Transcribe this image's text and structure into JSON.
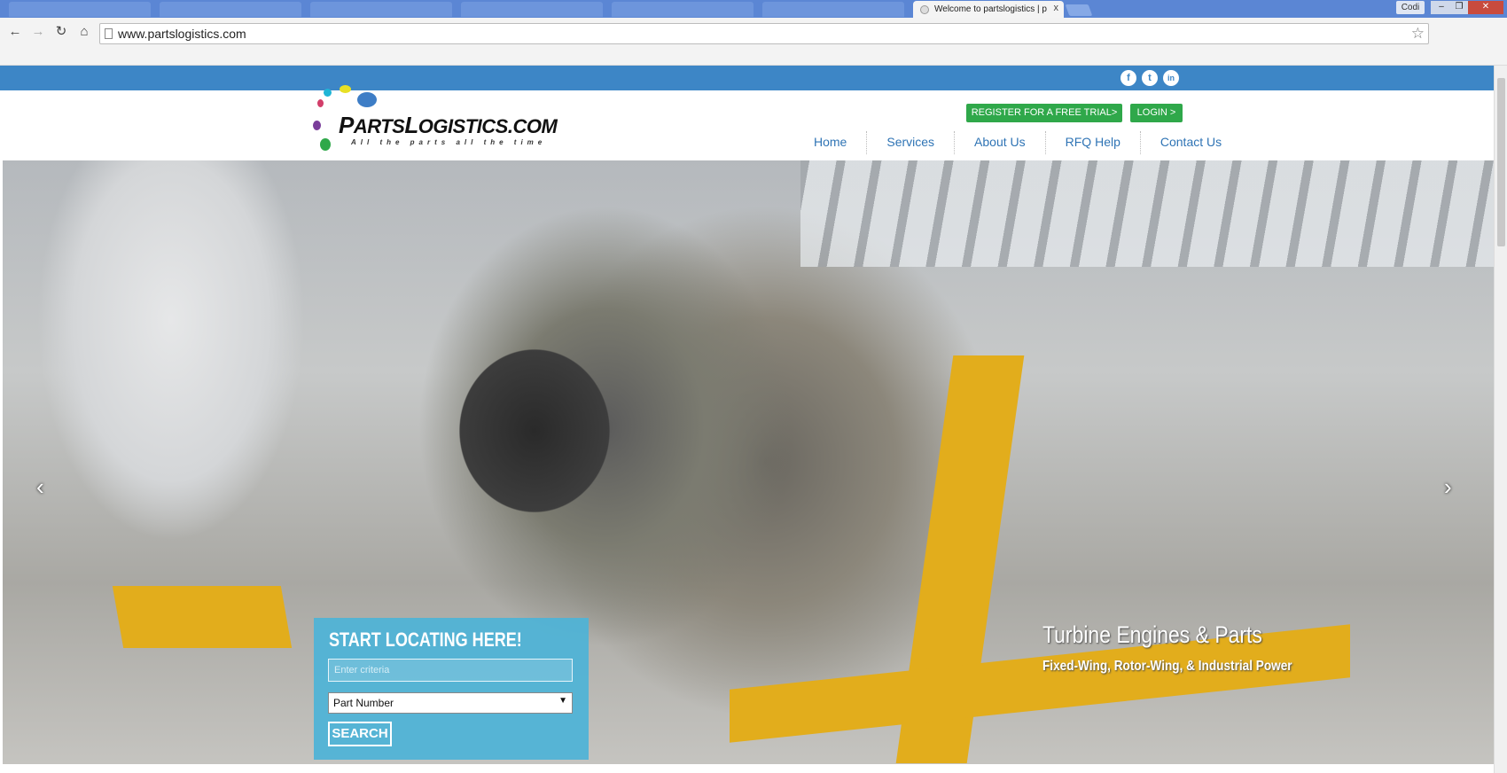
{
  "browser": {
    "tab_title": "Welcome to partslogistics | p",
    "tab_close": "x",
    "url": "www.partslogistics.com",
    "user_label": "Codi",
    "back_icon": "arrow-left-icon",
    "forward_icon": "arrow-right-icon",
    "reload_icon": "reload-icon",
    "home_icon": "home-icon",
    "star_icon": "star-icon"
  },
  "social": {
    "facebook": "f",
    "twitter": "t",
    "linkedin": "in"
  },
  "logo": {
    "part1_cap": "P",
    "part1": "ARTS",
    "part2_cap": "L",
    "part2": "OGISTICS",
    "suffix": ".COM",
    "tagline": "All the parts all the time"
  },
  "header": {
    "register_label": "REGISTER FOR A FREE TRIAL>",
    "login_label": "LOGIN >"
  },
  "nav": {
    "items": [
      "Home",
      "Services",
      "About Us",
      "RFQ Help",
      "Contact Us"
    ]
  },
  "hero": {
    "prev_arrow": "‹",
    "next_arrow": "›",
    "caption_title": "Turbine Engines & Parts",
    "caption_sub": "Fixed-Wing, Rotor-Wing, & Industrial Power"
  },
  "search": {
    "title": "START LOCATING HERE!",
    "placeholder": "Enter criteria",
    "select_value": "Part Number",
    "button_label": "SEARCH"
  },
  "colors": {
    "brand_blue": "#3d86c6",
    "cta_green": "#2fa84a",
    "search_panel": "#4db3d7"
  }
}
